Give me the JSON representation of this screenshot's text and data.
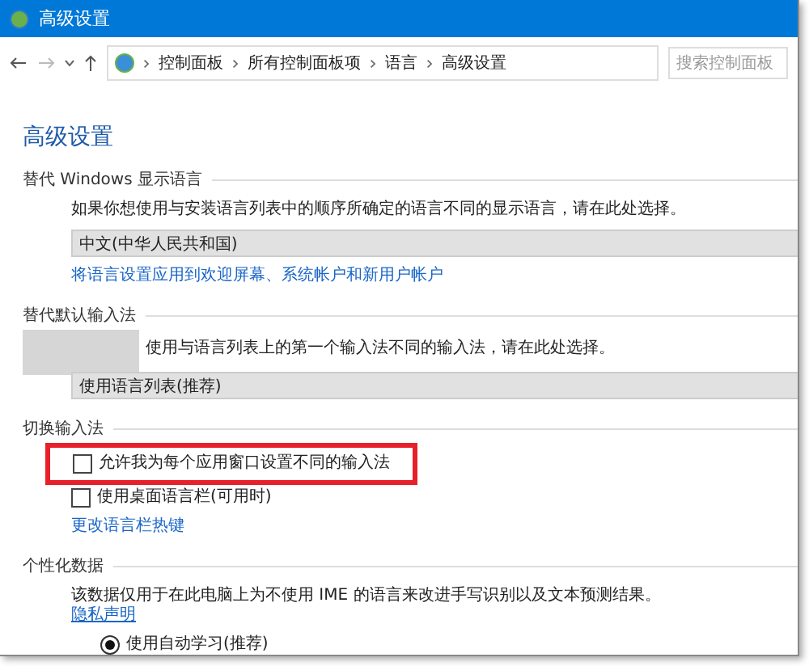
{
  "window": {
    "title": "高级设置"
  },
  "address_bar": {
    "crumbs": [
      "控制面板",
      "所有控制面板项",
      "语言",
      "高级设置"
    ]
  },
  "search": {
    "placeholder": "搜索控制面板"
  },
  "heading": "高级设置",
  "sections": [
    {
      "kind": "dropdown",
      "title": "替代 Windows 显示语言",
      "description": "如果你想使用与安装语言列表中的顺序所确定的语言不同的显示语言，请在此处选择。",
      "value": "中文(中华人民共和国)",
      "link": "将语言设置应用到欢迎屏幕、系统帐户和新用户帐户"
    },
    {
      "kind": "dropdown",
      "title": "替代默认输入法",
      "description": "使用与语言列表上的第一个输入法不同的输入法，请在此处选择。",
      "value": "使用语言列表(推荐)",
      "redacted": true
    },
    {
      "kind": "checkboxes",
      "title": "切换输入法",
      "options": [
        {
          "label": "允许我为每个应用窗口设置不同的输入法",
          "checked": false,
          "highlighted": true
        },
        {
          "label": "使用桌面语言栏(可用时)",
          "checked": false
        }
      ],
      "link": "更改语言栏热键"
    },
    {
      "kind": "radios",
      "title": "个性化数据",
      "description": "该数据仅用于在此电脑上为不使用 IME 的语言来改进手写识别以及文本预测结果。",
      "link": "隐私声明",
      "options": [
        {
          "label": "使用自动学习(推荐)",
          "selected": true
        }
      ]
    }
  ]
}
